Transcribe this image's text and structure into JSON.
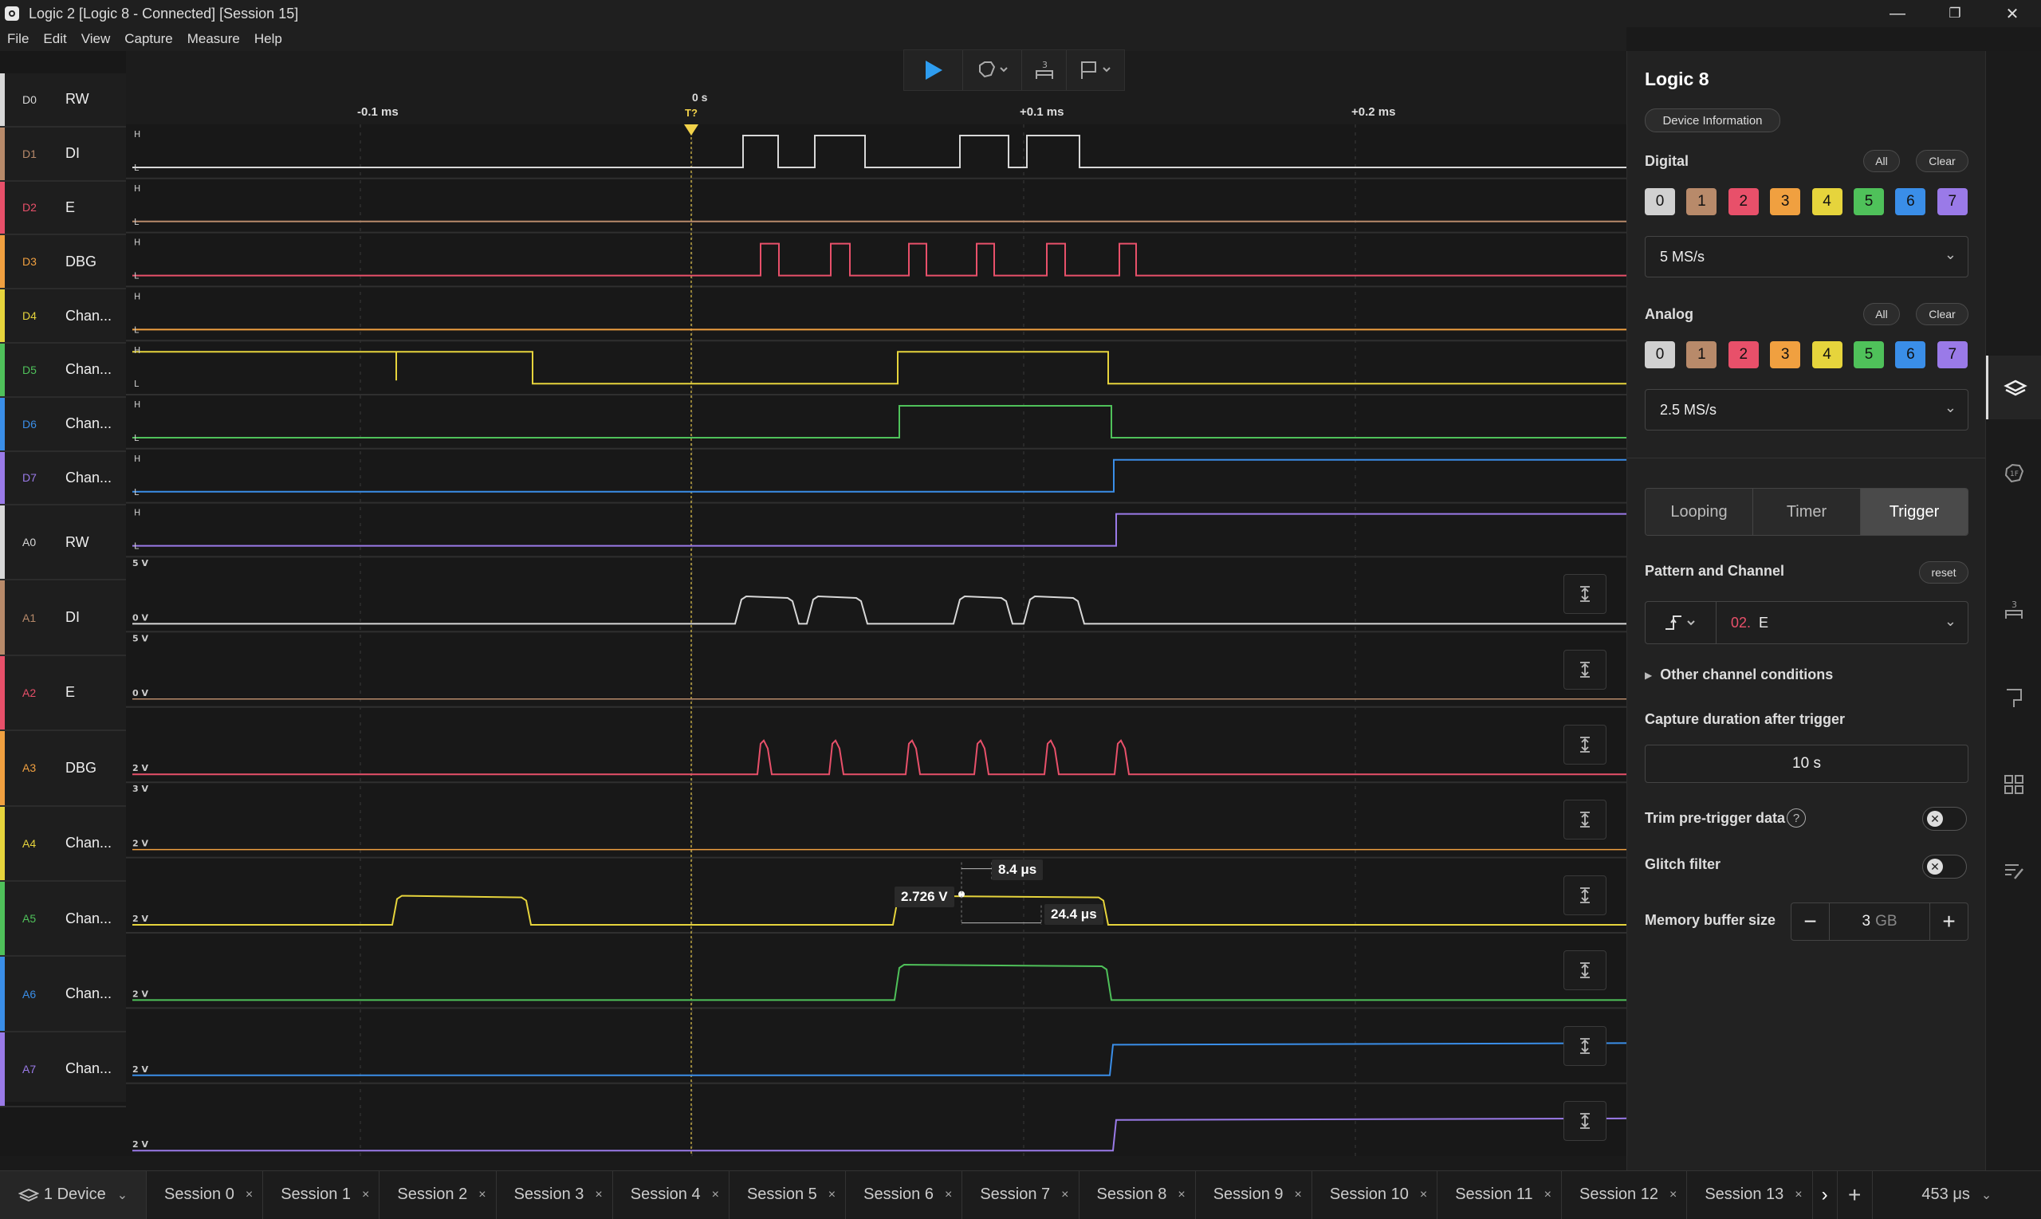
{
  "window": {
    "title": "Logic 2 [Logic 8 - Connected] [Session 15]",
    "minimize": "—",
    "restore": "❐",
    "close": "✕"
  },
  "menu": [
    "File",
    "Edit",
    "View",
    "Capture",
    "Measure",
    "Help"
  ],
  "toolbar": {
    "play_icon": "play-icon",
    "analyzer_icon": "analyzer-icon",
    "measure_icon": "measure-icon",
    "marker_icon": "marker-icon"
  },
  "timeline": {
    "labels": [
      "-0.1 ms",
      "0 s",
      "+0.1 ms",
      "+0.2 ms"
    ],
    "trigger_label": "T?"
  },
  "digital_channels": [
    {
      "id": "D0",
      "name": "RW",
      "color": "#d8d8d8"
    },
    {
      "id": "D1",
      "name": "DI",
      "color": "#b88a6a"
    },
    {
      "id": "D2",
      "name": "E",
      "color": "#e8506a"
    },
    {
      "id": "D3",
      "name": "DBG",
      "color": "#f0a040"
    },
    {
      "id": "D4",
      "name": "Chan...",
      "color": "#e6d43c"
    },
    {
      "id": "D5",
      "name": "Chan...",
      "color": "#4fc15a"
    },
    {
      "id": "D6",
      "name": "Chan...",
      "color": "#3a8ee8"
    },
    {
      "id": "D7",
      "name": "Chan...",
      "color": "#9a7ae8"
    }
  ],
  "analog_channels": [
    {
      "id": "A0",
      "name": "RW",
      "color": "#d8d8d8",
      "top_label": "5 V",
      "bottom_label": "0 V"
    },
    {
      "id": "A1",
      "name": "DI",
      "color": "#b88a6a",
      "top_label": "5 V",
      "bottom_label": "0 V"
    },
    {
      "id": "A2",
      "name": "E",
      "color": "#e8506a",
      "top_label": "",
      "bottom_label": "2 V"
    },
    {
      "id": "A3",
      "name": "DBG",
      "color": "#f0a040",
      "top_label": "3 V",
      "bottom_label": "2 V"
    },
    {
      "id": "A4",
      "name": "Chan...",
      "color": "#e6d43c",
      "top_label": "",
      "bottom_label": "2 V"
    },
    {
      "id": "A5",
      "name": "Chan...",
      "color": "#4fc15a",
      "top_label": "",
      "bottom_label": "2 V"
    },
    {
      "id": "A6",
      "name": "Chan...",
      "color": "#3a8ee8",
      "top_label": "",
      "bottom_label": "2 V"
    },
    {
      "id": "A7",
      "name": "Chan...",
      "color": "#9a7ae8",
      "top_label": "",
      "bottom_label": "2 V"
    }
  ],
  "measurements": {
    "voltage": "2.726 V",
    "width": "8.4 μs",
    "period": "24.4 μs"
  },
  "panel": {
    "title": "Logic 8",
    "device_info": "Device Information",
    "digital_label": "Digital",
    "analog_label": "Analog",
    "all": "All",
    "clear": "Clear",
    "chips": [
      "0",
      "1",
      "2",
      "3",
      "4",
      "5",
      "6",
      "7"
    ],
    "chip_colors": [
      "#d0d0d0",
      "#b88a6a",
      "#e8506a",
      "#f0a040",
      "#e6d43c",
      "#4fc15a",
      "#3a8ee8",
      "#9a7ae8"
    ],
    "digital_rate": "5 MS/s",
    "analog_rate": "2.5 MS/s",
    "modes": [
      "Looping",
      "Timer",
      "Trigger"
    ],
    "active_mode": "Trigger",
    "pattern_label": "Pattern and Channel",
    "reset": "reset",
    "trigger_channel_num": "02.",
    "trigger_channel_name": "E",
    "other_conditions": "Other channel conditions",
    "capture_duration_label": "Capture duration after trigger",
    "capture_duration": "10 s",
    "trim_label": "Trim pre-trigger data",
    "glitch_label": "Glitch filter",
    "memory_label": "Memory buffer size",
    "memory_value": "3",
    "memory_unit": "GB"
  },
  "tabs": {
    "device": "1 Device",
    "sessions": [
      "Session 0",
      "Session 1",
      "Session 2",
      "Session 3",
      "Session 4",
      "Session 5",
      "Session 6",
      "Session 7",
      "Session 8",
      "Session 9",
      "Session 10",
      "Session 11",
      "Session 12",
      "Session 13"
    ],
    "zoom": "453 μs"
  }
}
